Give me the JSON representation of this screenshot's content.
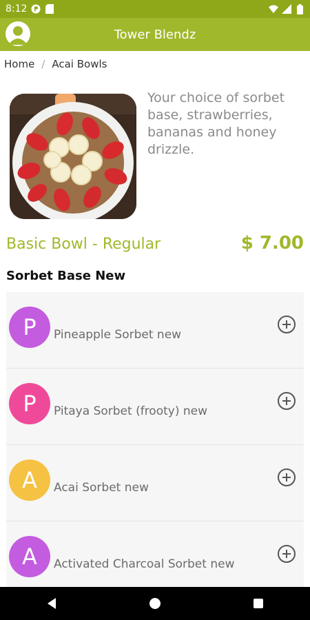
{
  "status_bar": {
    "time": "8:12"
  },
  "header": {
    "title": "Tower Blendz"
  },
  "breadcrumb": {
    "home": "Home",
    "separator": "/",
    "current": "Acai Bowls"
  },
  "product": {
    "description": "Your choice of sorbet base, strawberries, bananas and honey drizzle.",
    "name": "Basic Bowl - Regular",
    "price": "$ 7.00"
  },
  "section": {
    "title": "Sorbet Base New"
  },
  "options": [
    {
      "initial": "P",
      "label": "Pineapple Sorbet new",
      "color": "#c45ce0"
    },
    {
      "initial": "P",
      "label": "Pitaya Sorbet (frooty) new",
      "color": "#ef4a9a"
    },
    {
      "initial": "A",
      "label": "Acai Sorbet new",
      "color": "#f5c243"
    },
    {
      "initial": "A",
      "label": "Activated Charcoal Sorbet new",
      "color": "#c45ce0"
    }
  ],
  "colors": {
    "accent": "#a0b82b",
    "status_bar": "#8fa81a"
  },
  "icons": {
    "add": "plus-circle-icon",
    "avatar": "user-icon",
    "nav": [
      "back-icon",
      "home-icon",
      "recents-icon"
    ]
  }
}
